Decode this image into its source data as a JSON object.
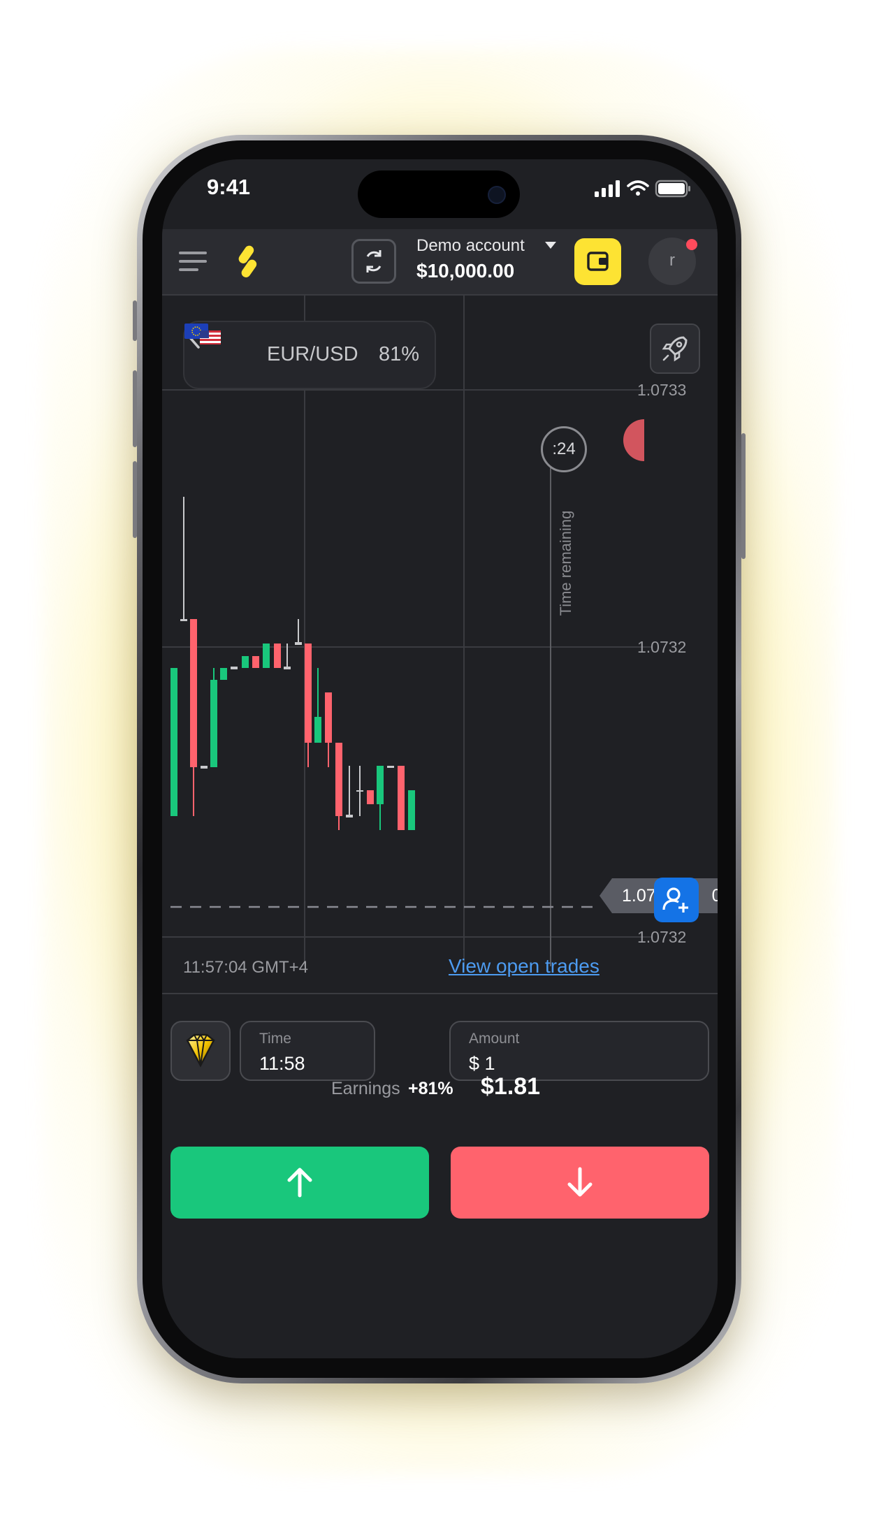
{
  "status_bar": {
    "time": "9:41"
  },
  "header": {
    "account_label": "Demo account",
    "balance": "$10,000.00",
    "avatar_initial": "r"
  },
  "asset": {
    "pair": "EUR/USD",
    "payout": "81%"
  },
  "chart": {
    "timer": ":24",
    "time_remaining_label": "Time remaining",
    "price_labels": [
      "1.0733",
      "1.0732",
      "1.0732"
    ],
    "current_price": "1.0732",
    "current_price_display": "1.073",
    "current_price_tail": "0",
    "clock": "11:57:04 GMT+4",
    "view_trades_link": "View open trades"
  },
  "chart_data": {
    "type": "candlestick",
    "colors": {
      "up": "#19c77c",
      "down": "#ff636d",
      "doji": "#c8c9cc"
    }
  },
  "trade_form": {
    "time_label": "Time",
    "time_value": "11:58",
    "amount_label": "Amount",
    "amount_value": "$ 1",
    "earnings_label": "Earnings",
    "earnings_pct": "+81%",
    "earnings_value": "$1.81"
  },
  "colors": {
    "accent_yellow": "#fde333",
    "up_green": "#19c77c",
    "down_red": "#ff636d",
    "link_blue": "#4d9bf0",
    "background": "#1f2024"
  },
  "icons": [
    "menu-icon",
    "logo-icon",
    "switch-account-icon",
    "wallet-icon",
    "rocket-icon",
    "back-chevron-icon",
    "eu-flag-icon",
    "us-flag-icon",
    "add-user-icon",
    "diamond-icon",
    "arrow-up-icon",
    "arrow-down-icon"
  ]
}
